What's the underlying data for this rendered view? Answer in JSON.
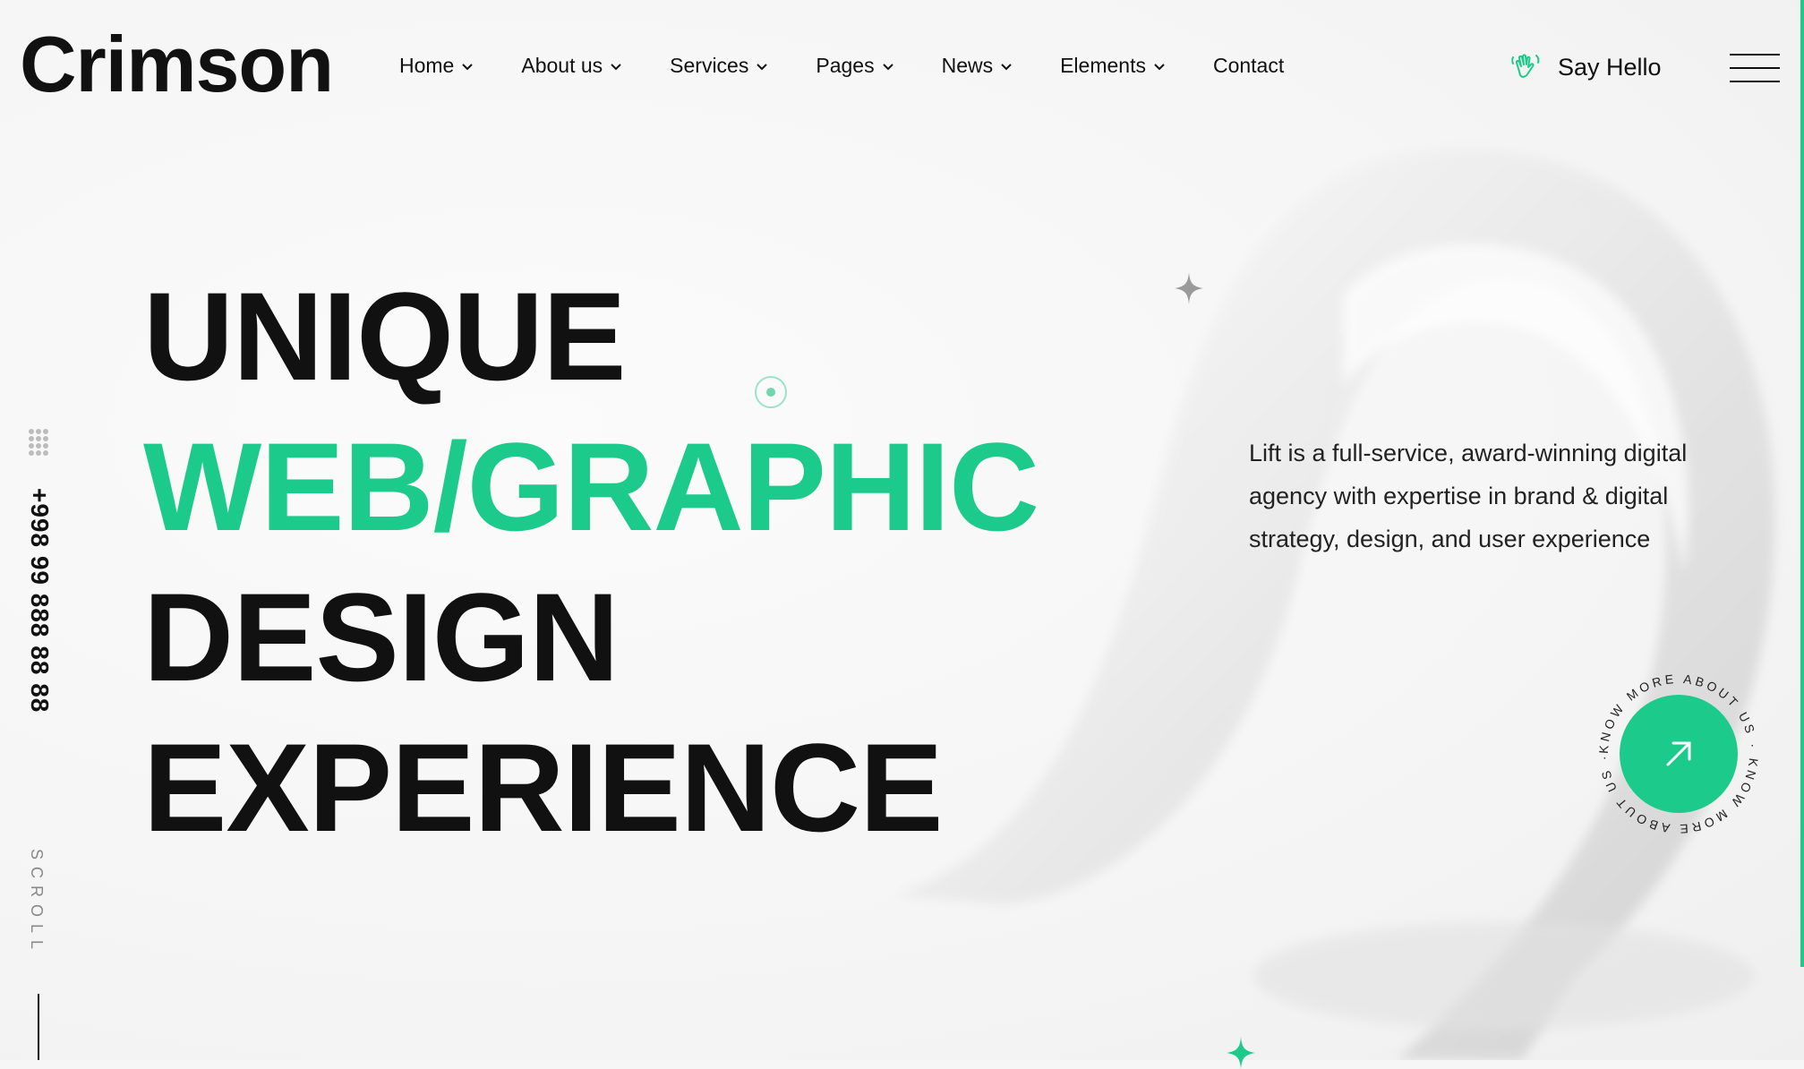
{
  "brand": {
    "logo": "Crimson",
    "accent_color": "#1ccb8c"
  },
  "nav": {
    "items": [
      {
        "label": "Home",
        "has_dropdown": true
      },
      {
        "label": "About us",
        "has_dropdown": true
      },
      {
        "label": "Services",
        "has_dropdown": true
      },
      {
        "label": "Pages",
        "has_dropdown": true
      },
      {
        "label": "News",
        "has_dropdown": true
      },
      {
        "label": "Elements",
        "has_dropdown": true
      },
      {
        "label": "Contact",
        "has_dropdown": false
      }
    ]
  },
  "header": {
    "say_hello": "Say Hello",
    "say_hello_icon": "waving-hand-icon",
    "menu_icon": "hamburger-menu-icon"
  },
  "hero": {
    "line1": "UNIQUE",
    "line2": "WEB/GRAPHIC",
    "line3": "DESIGN",
    "line4": "EXPERIENCE",
    "description": "Lift is a full-service, award-winning digital agency with expertise in brand & digital strategy, design, and user experience"
  },
  "side": {
    "phone": "+998 99 888 88 88",
    "scroll": "SCROLL",
    "dots_icon": "grid-dots-icon"
  },
  "cta": {
    "circle_text": "KNOW MORE ABOUT US · KNOW MORE ABOUT US · ",
    "icon": "arrow-up-right-icon"
  }
}
